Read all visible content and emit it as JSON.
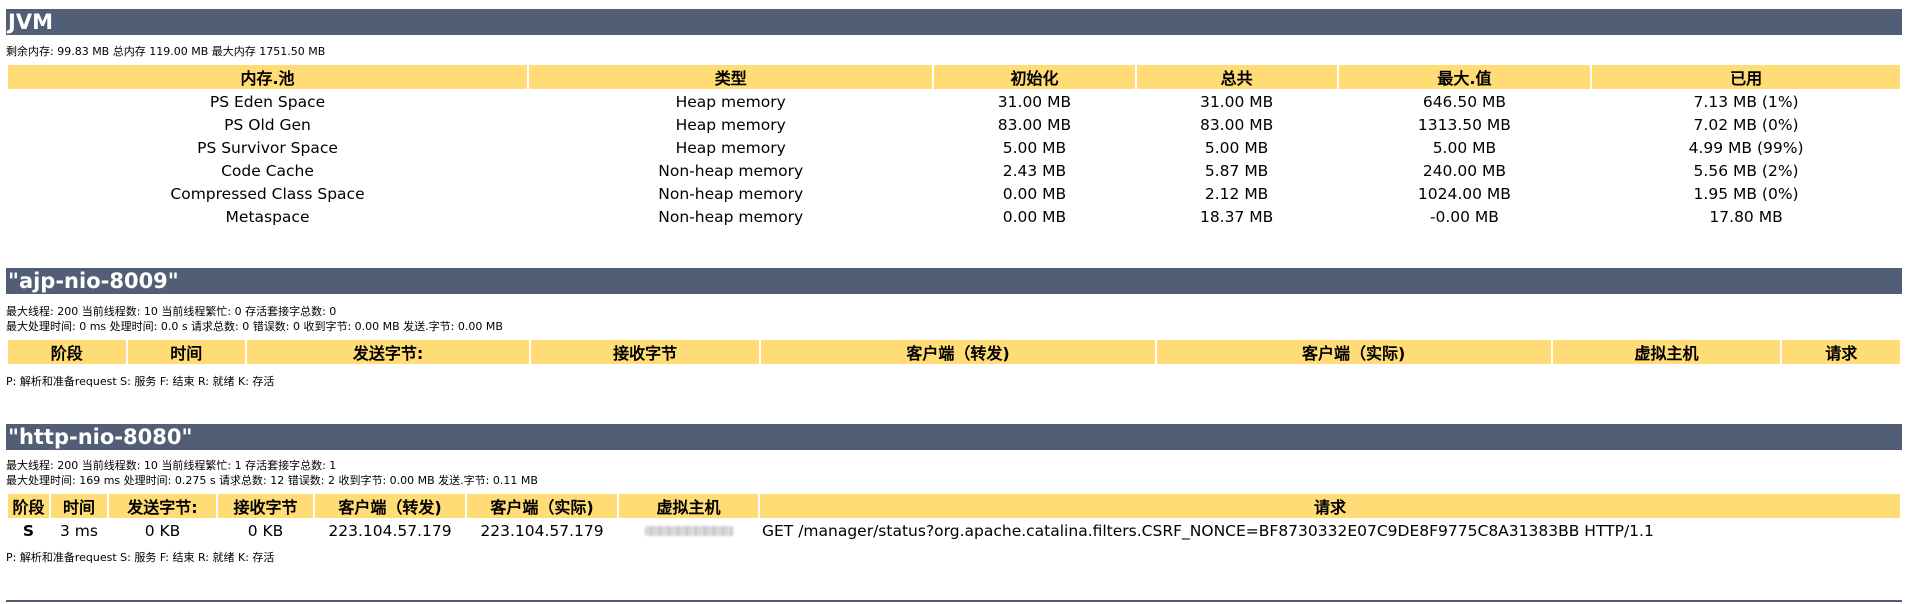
{
  "jvm": {
    "title": "JVM",
    "memory_text": "剩余内存:  99.83 MB 总内存 119.00 MB 最大内存 1751.50 MB",
    "headers": [
      "内存.池",
      "类型",
      "初始化",
      "总共",
      "最大.值",
      "已用"
    ],
    "rows": [
      [
        "PS Eden Space",
        "Heap memory",
        "31.00 MB",
        "31.00 MB",
        "646.50 MB",
        "7.13 MB (1%)"
      ],
      [
        "PS Old Gen",
        "Heap memory",
        "83.00 MB",
        "83.00 MB",
        "1313.50 MB",
        "7.02 MB (0%)"
      ],
      [
        "PS Survivor Space",
        "Heap memory",
        "5.00 MB",
        "5.00 MB",
        "5.00 MB",
        "4.99 MB (99%)"
      ],
      [
        "Code Cache",
        "Non-heap memory",
        "2.43 MB",
        "5.87 MB",
        "240.00 MB",
        "5.56 MB (2%)"
      ],
      [
        "Compressed Class Space",
        "Non-heap memory",
        "0.00 MB",
        "2.12 MB",
        "1024.00 MB",
        "1.95 MB (0%)"
      ],
      [
        "Metaspace",
        "Non-heap memory",
        "0.00 MB",
        "18.37 MB",
        "-0.00 MB",
        "17.80 MB"
      ]
    ]
  },
  "ajp": {
    "title": "\"ajp-nio-8009\"",
    "line1": "最大线程:  200 当前线程数:  10 当前线程繁忙:  0 存活套接字总数:  0",
    "line2": "最大处理时间:  0 ms 处理时间:  0.0 s 请求总数:  0 错误数:  0 收到字节:  0.00 MB 发送.字节: 0.00 MB",
    "headers": [
      "阶段",
      "时间",
      "发送字节:",
      "接收字节",
      "客户端（转发)",
      "客户端（实际)",
      "虚拟主机",
      "请求"
    ],
    "legend": "P: 解析和准备request S: 服务 F: 结束 R: 就绪 K: 存活"
  },
  "http": {
    "title": "\"http-nio-8080\"",
    "line1": "最大线程:  200 当前线程数:  10 当前线程繁忙:  1 存活套接字总数:  1",
    "line2": "最大处理时间:  169 ms 处理时间:  0.275 s 请求总数:  12 错误数:  2 收到字节:  0.00 MB 发送.字节: 0.11 MB",
    "headers": [
      "阶段",
      "时间",
      "发送字节:",
      "接收字节",
      "客户端（转发)",
      "客户端（实际)",
      "虚拟主机",
      "请求"
    ],
    "row": {
      "stage": "S",
      "time": "3 ms",
      "sent": "0 KB",
      "received": "0 KB",
      "client_forwarded": "223.104.57.179",
      "client_actual": "223.104.57.179",
      "request": "GET /manager/status?org.apache.catalina.filters.CSRF_NONCE=BF8730332E07C9DE8F9775C8A31383BB HTTP/1.1"
    },
    "legend": "P: 解析和准备request S: 服务 F: 结束 R: 就绪 K: 存活"
  }
}
